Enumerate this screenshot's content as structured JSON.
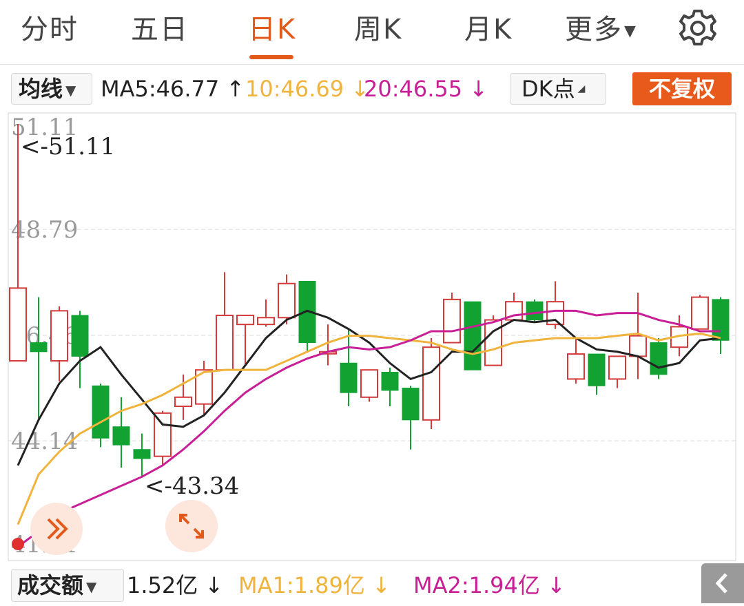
{
  "tabs": [
    {
      "label": "分时"
    },
    {
      "label": "五日"
    },
    {
      "label": "日K"
    },
    {
      "label": "周K"
    },
    {
      "label": "月K"
    },
    {
      "label": "更多"
    }
  ],
  "active_tab": "日K",
  "icons": {
    "settings": "gear-icon",
    "more": "caret-down-icon",
    "expand": "expand-icon",
    "fast_forward": "double-chevron-icon",
    "scroll": "chevron-left-icon"
  },
  "indicator": {
    "selector_label": "均线",
    "ma5": "MA5:46.77 ↑",
    "ma10": "10:46.69 ↓",
    "ma20": "20:46.55 ↓",
    "dk_label": "DK点",
    "fuquan_label": "不复权"
  },
  "volume": {
    "selector_label": "成交额",
    "value": "1.52亿 ↓",
    "ma1": "MA1:1.89亿 ↓",
    "ma2": "MA2:1.94亿 ↓"
  },
  "colors": {
    "accent": "#e15a1c",
    "up": "#d43a3a",
    "down": "#11a232",
    "ma5": "#222222",
    "ma10": "#f0b43c",
    "ma20": "#c81e96"
  },
  "chart_data": {
    "type": "candlestick",
    "ylim": [
      41.81,
      51.11
    ],
    "y_ticks": [
      "51.11",
      "48.79",
      "46.46",
      "44.14",
      "41.81"
    ],
    "max_label": "<-51.11",
    "min_label": "<-43.34",
    "candles": [
      {
        "o": 45.9,
        "c": 47.5,
        "h": 51.11,
        "l": 45.9
      },
      {
        "o": 46.3,
        "c": 46.1,
        "h": 47.3,
        "l": 44.6
      },
      {
        "o": 45.9,
        "c": 47.0,
        "h": 47.1,
        "l": 45.45
      },
      {
        "o": 46.9,
        "c": 46.0,
        "h": 47.0,
        "l": 45.3
      },
      {
        "o": 45.35,
        "c": 44.2,
        "h": 45.4,
        "l": 44.0
      },
      {
        "o": 44.45,
        "c": 44.05,
        "h": 45.1,
        "l": 43.55
      },
      {
        "o": 43.95,
        "c": 43.75,
        "h": 44.3,
        "l": 43.34
      },
      {
        "o": 43.8,
        "c": 44.75,
        "h": 44.8,
        "l": 43.6
      },
      {
        "o": 44.9,
        "c": 45.1,
        "h": 45.6,
        "l": 44.6
      },
      {
        "o": 44.95,
        "c": 45.7,
        "h": 45.9,
        "l": 44.7
      },
      {
        "o": 45.7,
        "c": 46.9,
        "h": 47.85,
        "l": 45.7
      },
      {
        "o": 46.7,
        "c": 46.9,
        "h": 46.9,
        "l": 45.8
      },
      {
        "o": 46.7,
        "c": 46.85,
        "h": 47.25,
        "l": 46.65
      },
      {
        "o": 46.85,
        "c": 47.6,
        "h": 47.8,
        "l": 46.7
      },
      {
        "o": 47.65,
        "c": 46.3,
        "h": 47.65,
        "l": 46.1
      },
      {
        "o": 46.1,
        "c": 46.1,
        "h": 46.7,
        "l": 45.8
      },
      {
        "o": 45.85,
        "c": 45.2,
        "h": 46.6,
        "l": 44.9
      },
      {
        "o": 45.1,
        "c": 45.7,
        "h": 45.7,
        "l": 45.0
      },
      {
        "o": 45.65,
        "c": 45.25,
        "h": 45.75,
        "l": 44.9
      },
      {
        "o": 45.3,
        "c": 44.6,
        "h": 45.35,
        "l": 43.95
      },
      {
        "o": 44.6,
        "c": 46.2,
        "h": 46.4,
        "l": 44.4
      },
      {
        "o": 46.3,
        "c": 47.25,
        "h": 47.4,
        "l": 46.3
      },
      {
        "o": 47.2,
        "c": 45.7,
        "h": 47.2,
        "l": 45.7
      },
      {
        "o": 45.8,
        "c": 46.8,
        "h": 46.9,
        "l": 45.8
      },
      {
        "o": 46.8,
        "c": 47.2,
        "h": 47.4,
        "l": 46.8
      },
      {
        "o": 47.2,
        "c": 46.8,
        "h": 47.25,
        "l": 46.75
      },
      {
        "o": 46.7,
        "c": 47.2,
        "h": 47.65,
        "l": 46.6
      },
      {
        "o": 45.5,
        "c": 46.05,
        "h": 46.4,
        "l": 45.4
      },
      {
        "o": 46.05,
        "c": 45.35,
        "h": 46.05,
        "l": 45.15
      },
      {
        "o": 45.5,
        "c": 46.0,
        "h": 46.0,
        "l": 45.3
      },
      {
        "o": 46.0,
        "c": 46.45,
        "h": 47.4,
        "l": 45.5
      },
      {
        "o": 46.3,
        "c": 45.6,
        "h": 46.4,
        "l": 45.5
      },
      {
        "o": 46.2,
        "c": 46.65,
        "h": 46.9,
        "l": 46.0
      },
      {
        "o": 46.6,
        "c": 47.3,
        "h": 47.35,
        "l": 46.6
      },
      {
        "o": 47.25,
        "c": 46.35,
        "h": 47.3,
        "l": 46.05
      }
    ],
    "series": [
      {
        "name": "MA5",
        "values": [
          43.6,
          44.6,
          45.4,
          45.9,
          46.2,
          45.6,
          45.05,
          44.5,
          44.45,
          44.7,
          45.2,
          45.8,
          46.4,
          46.8,
          47.0,
          46.85,
          46.6,
          46.3,
          45.85,
          45.5,
          45.65,
          46.1,
          46.1,
          46.55,
          46.8,
          46.75,
          46.8,
          46.4,
          46.15,
          46.1,
          46.0,
          45.75,
          45.85,
          46.35,
          46.4
        ]
      },
      {
        "name": "MA10",
        "values": [
          42.3,
          43.4,
          43.9,
          44.3,
          44.55,
          44.8,
          44.95,
          45.15,
          45.4,
          45.65,
          45.7,
          45.7,
          45.7,
          45.9,
          46.1,
          46.3,
          46.45,
          46.45,
          46.4,
          46.35,
          46.3,
          46.15,
          46.05,
          46.15,
          46.3,
          46.35,
          46.4,
          46.4,
          46.4,
          46.45,
          46.5,
          46.35,
          46.45,
          46.5,
          46.4
        ]
      },
      {
        "name": "MA20",
        "values": [
          41.81,
          42.15,
          42.55,
          42.75,
          42.95,
          43.15,
          43.35,
          43.6,
          43.95,
          44.35,
          44.8,
          45.2,
          45.5,
          45.75,
          45.95,
          46.1,
          46.2,
          46.15,
          46.2,
          46.35,
          46.55,
          46.55,
          46.65,
          46.75,
          46.9,
          46.95,
          47.0,
          47.0,
          46.9,
          46.95,
          46.95,
          46.8,
          46.7,
          46.55,
          46.55
        ]
      }
    ]
  }
}
